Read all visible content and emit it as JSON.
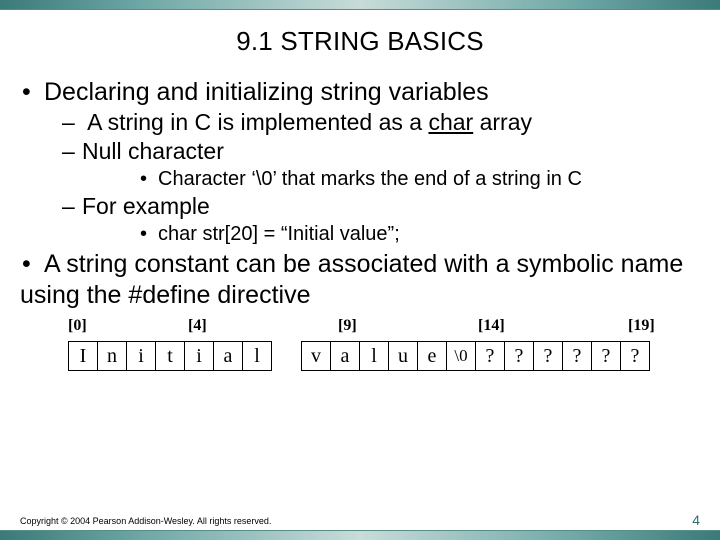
{
  "title": "9.1 STRING BASICS",
  "bullets": {
    "b1": "Declaring and initializing string variables",
    "b1a_pre": "A string in C is implemented as a ",
    "b1a_u": "char",
    "b1a_post": " array",
    "b1b": "Null character",
    "b1b1": "Character ‘\\0’ that marks the end of a string in C",
    "b1c": "For example",
    "b1c1": "char str[20] = “Initial value”;",
    "b2": "A string constant can be associated with a symbolic name using the #define directive"
  },
  "indices": {
    "i0": "[0]",
    "i4": "[4]",
    "i9": "[9]",
    "i14": "[14]",
    "i19": "[19]"
  },
  "cells": {
    "c0": "I",
    "c1": "n",
    "c2": "i",
    "c3": "t",
    "c4": "i",
    "c5": "a",
    "c6": "l",
    "c8": "v",
    "c9": "a",
    "c10": "l",
    "c11": "u",
    "c12": "e",
    "c13": "\\0",
    "c14": "?",
    "c15": "?",
    "c16": "?",
    "c17": "?",
    "c18": "?",
    "c19": "?"
  },
  "footer": "Copyright © 2004 Pearson Addison-Wesley. All rights reserved.",
  "page": "4"
}
